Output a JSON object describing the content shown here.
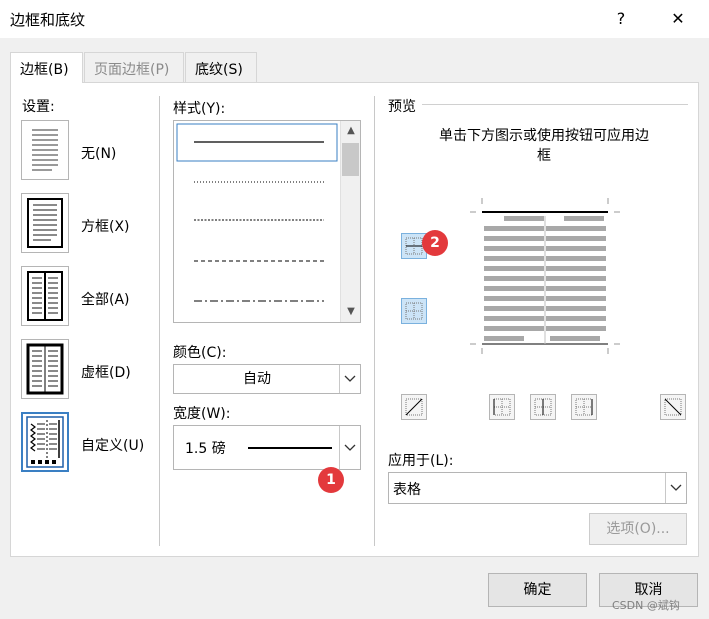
{
  "window": {
    "title": "边框和底纹",
    "help": "?",
    "close": "✕"
  },
  "tabs": [
    {
      "label": "边框(B)",
      "active": true
    },
    {
      "label": "页面边框(P)",
      "active": false
    },
    {
      "label": "底纹(S)",
      "active": false
    }
  ],
  "settings": {
    "heading": "设置:",
    "items": [
      {
        "label": "无(N)",
        "icon": "no-border-icon"
      },
      {
        "label": "方框(X)",
        "icon": "box-border-icon"
      },
      {
        "label": "全部(A)",
        "icon": "all-borders-icon"
      },
      {
        "label": "虚框(D)",
        "icon": "grid-border-icon"
      },
      {
        "label": "自定义(U)",
        "icon": "custom-border-icon",
        "selected": true
      }
    ]
  },
  "style": {
    "heading": "样式(Y):",
    "line_styles": [
      "solid",
      "dotted",
      "dashed-fine",
      "dashed",
      "dash-dot"
    ],
    "selected_index": 0
  },
  "color": {
    "heading": "颜色(C):",
    "value": "自动"
  },
  "width": {
    "heading": "宽度(W):",
    "value": "1.5 磅"
  },
  "preview": {
    "heading": "预览",
    "instruction": "单击下方图示或使用按钮可应用边框"
  },
  "apply_to": {
    "heading": "应用于(L):",
    "value": "表格"
  },
  "buttons": {
    "options": "选项(O)...",
    "ok": "确定",
    "cancel": "取消"
  },
  "badges": {
    "one": "1",
    "two": "2"
  },
  "watermark": "CSDN @斌钩",
  "colors": {
    "accent": "#3a7fc3",
    "badge": "#e3393c"
  }
}
